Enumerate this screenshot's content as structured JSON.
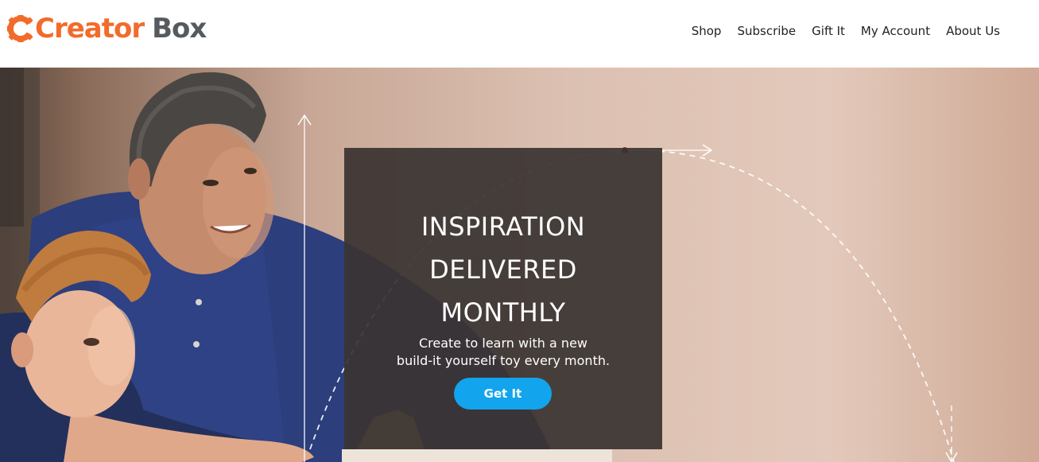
{
  "brand": {
    "name_part1": "Creator",
    "name_part2": "Box",
    "primary_color": "#f26b2b",
    "secondary_color": "#555a5f"
  },
  "nav": {
    "items": [
      {
        "label": "Shop"
      },
      {
        "label": "Subscribe"
      },
      {
        "label": "Gift It"
      },
      {
        "label": "My Account"
      },
      {
        "label": "About Us"
      }
    ]
  },
  "hero": {
    "headline_lines": [
      "INSPIRATION",
      "DELIVERED",
      "MONTHLY"
    ],
    "subtext_lines": [
      "Create to learn with a new",
      "build-it yourself toy every month."
    ],
    "cta_label": "Get It",
    "cta_color": "#12a4ec",
    "overlay_color": "#3a3432"
  }
}
